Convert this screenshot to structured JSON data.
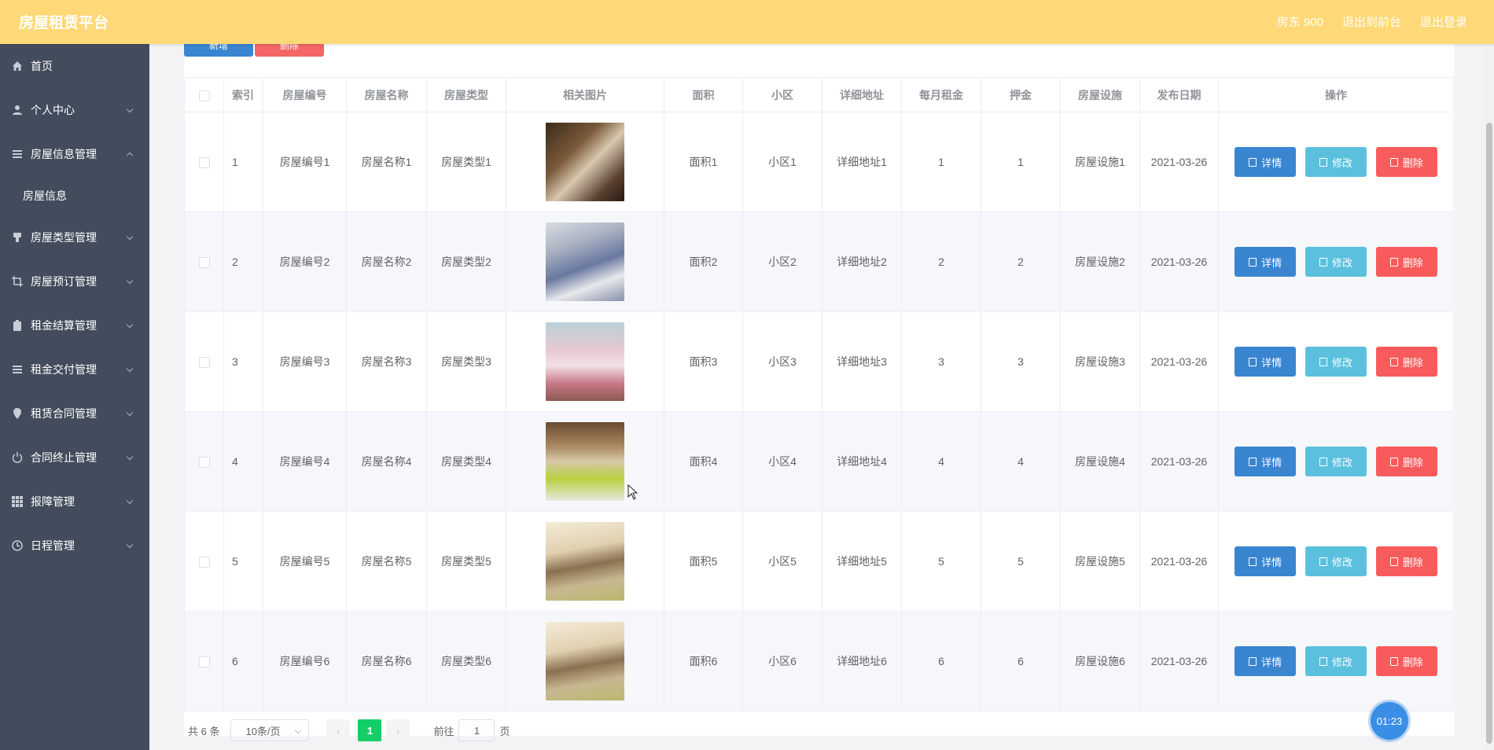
{
  "header": {
    "brand": "房屋租赁平台",
    "user": "房东 900",
    "to_front": "退出到前台",
    "logout": "退出登录"
  },
  "sidebar": {
    "items": [
      {
        "label": "首页",
        "icon": "home-icon"
      },
      {
        "label": "个人中心",
        "icon": "user-icon"
      },
      {
        "label": "房屋信息管理",
        "icon": "list-icon",
        "expanded": true
      },
      {
        "label": "房屋类型管理",
        "icon": "stamp-icon"
      },
      {
        "label": "房屋预订管理",
        "icon": "crop-icon"
      },
      {
        "label": "租金结算管理",
        "icon": "clipboard-icon"
      },
      {
        "label": "租金交付管理",
        "icon": "list-icon"
      },
      {
        "label": "租赁合同管理",
        "icon": "location-icon"
      },
      {
        "label": "合同终止管理",
        "icon": "power-icon"
      },
      {
        "label": "报障管理",
        "icon": "grid-icon"
      },
      {
        "label": "日程管理",
        "icon": "clock-icon"
      }
    ],
    "submenu": {
      "label": "房屋信息"
    }
  },
  "toolbar": {
    "add_label": "新增",
    "delete_label": "删除"
  },
  "table": {
    "headers": [
      "索引",
      "房屋编号",
      "房屋名称",
      "房屋类型",
      "相关图片",
      "面积",
      "小区",
      "详细地址",
      "每月租金",
      "押金",
      "房屋设施",
      "发布日期",
      "操作"
    ],
    "rows": [
      {
        "index": "1",
        "code": "房屋编号1",
        "name": "房屋名称1",
        "type": "房屋类型1",
        "area": "面积1",
        "community": "小区1",
        "address": "详细地址1",
        "rent": "1",
        "deposit": "1",
        "facility": "房屋设施1",
        "date": "2021-03-26"
      },
      {
        "index": "2",
        "code": "房屋编号2",
        "name": "房屋名称2",
        "type": "房屋类型2",
        "area": "面积2",
        "community": "小区2",
        "address": "详细地址2",
        "rent": "2",
        "deposit": "2",
        "facility": "房屋设施2",
        "date": "2021-03-26"
      },
      {
        "index": "3",
        "code": "房屋编号3",
        "name": "房屋名称3",
        "type": "房屋类型3",
        "area": "面积3",
        "community": "小区3",
        "address": "详细地址3",
        "rent": "3",
        "deposit": "3",
        "facility": "房屋设施3",
        "date": "2021-03-26"
      },
      {
        "index": "4",
        "code": "房屋编号4",
        "name": "房屋名称4",
        "type": "房屋类型4",
        "area": "面积4",
        "community": "小区4",
        "address": "详细地址4",
        "rent": "4",
        "deposit": "4",
        "facility": "房屋设施4",
        "date": "2021-03-26"
      },
      {
        "index": "5",
        "code": "房屋编号5",
        "name": "房屋名称5",
        "type": "房屋类型5",
        "area": "面积5",
        "community": "小区5",
        "address": "详细地址5",
        "rent": "5",
        "deposit": "5",
        "facility": "房屋设施5",
        "date": "2021-03-26"
      },
      {
        "index": "6",
        "code": "房屋编号6",
        "name": "房屋名称6",
        "type": "房屋类型6",
        "area": "面积6",
        "community": "小区6",
        "address": "详细地址6",
        "rent": "6",
        "deposit": "6",
        "facility": "房屋设施6",
        "date": "2021-03-26"
      }
    ],
    "actions": {
      "detail": "详情",
      "edit": "修改",
      "delete": "删除"
    }
  },
  "pagination": {
    "total": "共 6 条",
    "page_size": "10条/页",
    "current_page": "1",
    "goto_prefix": "前往",
    "goto_value": "1",
    "goto_suffix": "页"
  },
  "timer": "01:23",
  "colors": {
    "header_bg": "#ffd877",
    "sidebar_bg": "#424c5c",
    "primary": "#3a85d0",
    "info": "#5bc0de",
    "danger": "#f85b5b",
    "page_active": "#13ce66"
  }
}
